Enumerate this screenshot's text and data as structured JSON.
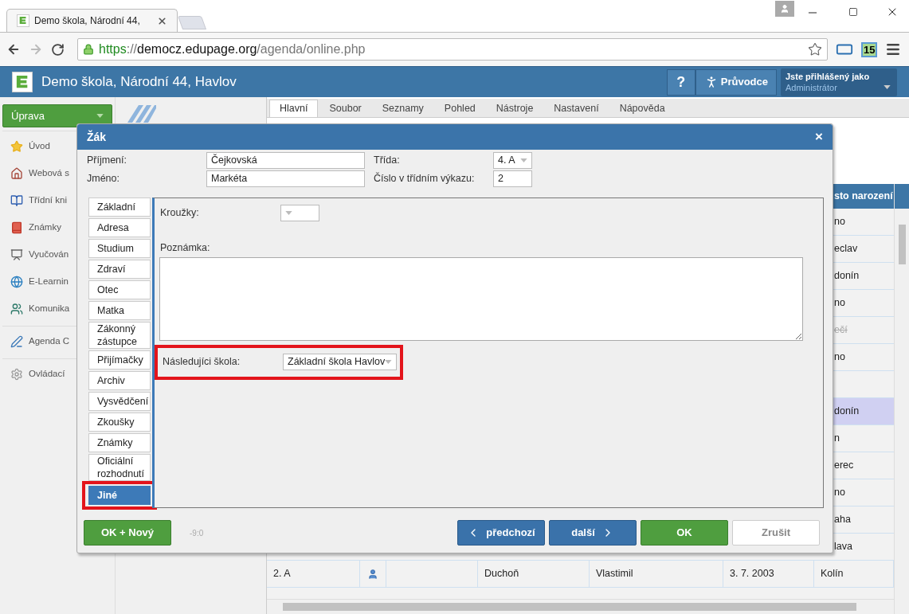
{
  "browser": {
    "tab": {
      "title": "Demo škola, Národní 44,"
    },
    "url": {
      "scheme": "https",
      "separator": "://",
      "host": "democz.edupage.org",
      "path": "/agenda/online.php"
    },
    "extension_badge": "15"
  },
  "app_header": {
    "title": "Demo škola, Národní 44, Havlov",
    "help": "?",
    "guide": "Průvodce",
    "user_caption": "Jste přihlášený jako",
    "user_name": "Administrátor"
  },
  "sidebar": {
    "menu_button": "Úprava",
    "groups": [
      [
        {
          "label": "Úvod"
        },
        {
          "label": "Webová s"
        },
        {
          "label": "Třídní kni"
        },
        {
          "label": "Známky"
        },
        {
          "label": "Vyučován"
        },
        {
          "label": "E-Learnin"
        },
        {
          "label": "Komunika"
        }
      ],
      [
        {
          "label": "Agenda C"
        }
      ],
      [
        {
          "label": "Ovládací"
        }
      ]
    ]
  },
  "menu_tabs": [
    {
      "label": "Hlavní",
      "selected": true
    },
    {
      "label": "Soubor",
      "selected": false
    },
    {
      "label": "Seznamy",
      "selected": false
    },
    {
      "label": "Pohled",
      "selected": false
    },
    {
      "label": "Nástroje",
      "selected": false
    },
    {
      "label": "Nastavení",
      "selected": false
    },
    {
      "label": "Nápověda",
      "selected": false
    }
  ],
  "table": {
    "header_fragment": "sto narození",
    "rows": [
      {
        "kind": "covered",
        "fragment": "no",
        "selected": false,
        "inactive": false
      },
      {
        "kind": "covered",
        "fragment": "eclav",
        "selected": false,
        "inactive": false
      },
      {
        "kind": "covered",
        "fragment": "donín",
        "selected": false,
        "inactive": false
      },
      {
        "kind": "covered",
        "fragment": "no",
        "selected": false,
        "inactive": false
      },
      {
        "kind": "covered",
        "fragment": "ečí",
        "selected": false,
        "inactive": true
      },
      {
        "kind": "covered",
        "fragment": "no",
        "selected": false,
        "inactive": false
      },
      {
        "kind": "covered",
        "selected": false
      },
      {
        "kind": "covered",
        "fragment": "donín",
        "selected": true,
        "inactive": false
      },
      {
        "kind": "covered",
        "fragment": "n",
        "selected": false,
        "inactive": false
      },
      {
        "kind": "covered",
        "fragment": "erec",
        "selected": false,
        "inactive": false
      },
      {
        "kind": "covered",
        "fragment": "no",
        "selected": false,
        "inactive": false
      },
      {
        "kind": "covered",
        "fragment": "aha",
        "selected": false,
        "inactive": false
      },
      {
        "kind": "covered",
        "fragment": "lava",
        "selected": false,
        "inactive": false
      },
      {
        "kind": "full",
        "class": "2. A",
        "surname": "Duchoň",
        "first_name": "Vlastimil",
        "birth_date": "3. 7. 2003",
        "birthplace": "Kolín",
        "selected": false,
        "inactive": false
      }
    ]
  },
  "dialog": {
    "title": "Žák",
    "close": "×",
    "fields": {
      "surname": {
        "label": "Příjmení:",
        "value": "Čejkovská"
      },
      "first_name": {
        "label": "Jméno:",
        "value": "Markéta"
      },
      "class": {
        "label": "Třída:",
        "value": "4. A"
      },
      "number": {
        "label": "Číslo v třídním výkazu:",
        "value": "2"
      }
    },
    "tabs": [
      {
        "label": "Základní",
        "selected": false,
        "highlighted": false
      },
      {
        "label": "Adresa",
        "selected": false,
        "highlighted": false
      },
      {
        "label": "Studium",
        "selected": false,
        "highlighted": false
      },
      {
        "label": "Zdraví",
        "selected": false,
        "highlighted": false
      },
      {
        "label": "Otec",
        "selected": false,
        "highlighted": false
      },
      {
        "label": "Matka",
        "selected": false,
        "highlighted": false
      },
      {
        "label": "Zákonný zástupce",
        "selected": false,
        "highlighted": false
      },
      {
        "label": "Přijímačky",
        "selected": false,
        "highlighted": false
      },
      {
        "label": "Archiv",
        "selected": false,
        "highlighted": false
      },
      {
        "label": "Vysvědčení",
        "selected": false,
        "highlighted": false
      },
      {
        "label": "Zkoušky",
        "selected": false,
        "highlighted": false
      },
      {
        "label": "Známky",
        "selected": false,
        "highlighted": false
      },
      {
        "label": "Oficiální rozhodnutí",
        "selected": false,
        "highlighted": false
      },
      {
        "label": "Jiné",
        "selected": true,
        "highlighted": true
      }
    ],
    "panel": {
      "clubs": {
        "label": "Kroužky:"
      },
      "note": {
        "label": "Poznámka:"
      },
      "next_school": {
        "label": "Následujíci škola:",
        "value": "Základní škola Havlov",
        "highlighted": true
      }
    },
    "footer": {
      "ok_new": "OK + Nový",
      "code": "-9:0",
      "previous": "předchozí",
      "next": "další",
      "ok": "OK",
      "cancel": "Zrušit"
    }
  }
}
